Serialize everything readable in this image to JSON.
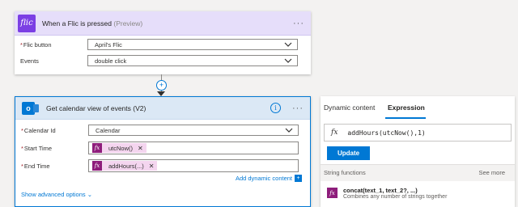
{
  "flic_card": {
    "title": "When a Flic is pressed",
    "title_suffix": "(Preview)",
    "logo_text": "flic",
    "fields": [
      {
        "label": "Flic button",
        "required": "*",
        "value": "April's Flic"
      },
      {
        "label": "Events",
        "required": "",
        "value": "double click"
      }
    ]
  },
  "connector": {
    "plus": "+"
  },
  "outlook_card": {
    "title": "Get calendar view of events (V2)",
    "logo_text": "o",
    "info": "i",
    "fields": {
      "calendar_id": {
        "label": "Calendar Id",
        "required": "*",
        "value": "Calendar"
      },
      "start_time": {
        "label": "Start Time",
        "required": "*",
        "token": "utcNow()"
      },
      "end_time": {
        "label": "End Time",
        "required": "*",
        "token": "addHours(...)"
      }
    },
    "add_dynamic": "Add dynamic content",
    "show_advanced": "Show advanced options"
  },
  "panel": {
    "tabs": [
      "Dynamic content",
      "Expression"
    ],
    "active_tab": "Expression",
    "expression_value": "addHours(utcNow(),1)",
    "fx_glyph": "fx",
    "update_label": "Update",
    "section_title": "String functions",
    "see_more": "See more",
    "function": {
      "name": "concat(text_1, text_2?, ...)",
      "description": "Combines any number of strings together"
    }
  },
  "colors": {
    "accent": "#0078d4",
    "flic_header": "#e6defa",
    "outlook_header": "#dbe8f5",
    "token": "#8e1d7b"
  },
  "icons": {
    "more": "more-dots-icon",
    "chevron": "chevron-down-icon",
    "remove": "close-icon",
    "info": "info-icon",
    "add": "add-dynamic-icon"
  }
}
